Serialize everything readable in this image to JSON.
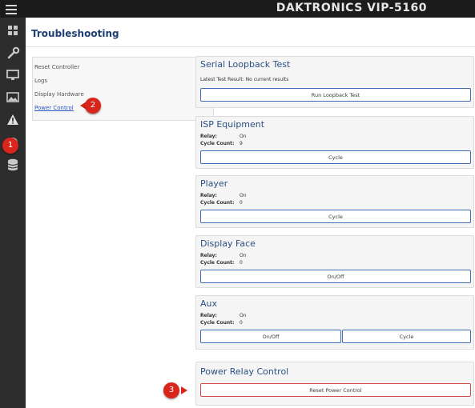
{
  "topbar": {
    "brand": "DAKTRONICS VIP-5160",
    "menu_icon": "hamburger-icon"
  },
  "sidebar": {
    "icons": [
      "dashboard-icon",
      "wrench-icon",
      "monitor-icon",
      "image-icon",
      "warning-icon",
      "info-icon",
      "database-icon"
    ]
  },
  "page": {
    "title": "Troubleshooting"
  },
  "leftnav": {
    "items": [
      {
        "label": "Reset Controller"
      },
      {
        "label": "Logs"
      },
      {
        "label": "Display Hardware"
      },
      {
        "label": "Power Control"
      }
    ]
  },
  "panels": {
    "serial": {
      "title": "Serial Loopback Test",
      "result_text": "Latest Test Result: No current results",
      "button": "Run Loopback Test"
    },
    "isp": {
      "title": "ISP Equipment",
      "relay_label": "Relay:",
      "relay_value": "On",
      "cycle_label": "Cycle Count:",
      "cycle_value": "9",
      "button": "Cycle"
    },
    "player": {
      "title": "Player",
      "relay_label": "Relay:",
      "relay_value": "On",
      "cycle_label": "Cycle Count:",
      "cycle_value": "0",
      "button": "Cycle"
    },
    "display_face": {
      "title": "Display Face",
      "relay_label": "Relay:",
      "relay_value": "On",
      "cycle_label": "Cycle Count:",
      "cycle_value": "0",
      "button": "On/Off"
    },
    "aux": {
      "title": "Aux",
      "relay_label": "Relay:",
      "relay_value": "On",
      "cycle_label": "Cycle Count:",
      "cycle_value": "0",
      "button_onoff": "On/Off",
      "button_cycle": "Cycle"
    },
    "power_relay": {
      "title": "Power Relay Control",
      "button": "Reset Power Control"
    }
  },
  "markers": {
    "one": "1",
    "two": "2",
    "three": "3"
  },
  "colors": {
    "accent": "#1d3f73",
    "marker": "#d9261c",
    "danger_border": "#d24a4a"
  }
}
